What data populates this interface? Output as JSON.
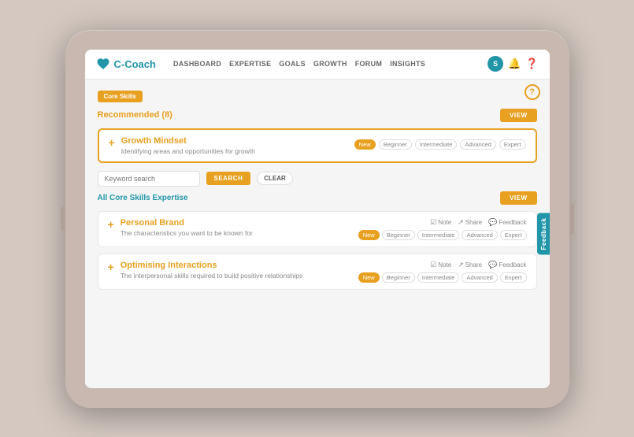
{
  "app": {
    "logo_text": "C-Coach",
    "nav": {
      "items": [
        {
          "label": "DASHBOARD"
        },
        {
          "label": "EXPERTISE"
        },
        {
          "label": "GOALS"
        },
        {
          "label": "GROWTH"
        },
        {
          "label": "FORUM"
        },
        {
          "label": "INSIGHTS"
        }
      ],
      "user_initial": "S"
    }
  },
  "content": {
    "help_icon": "?",
    "core_skills_badge": "Core Skills",
    "recommended_label": "Recommended (8)",
    "view_btn": "VIEW",
    "growth_card": {
      "title": "Growth Mindset",
      "description": "Identifying areas and opportunities for growth",
      "levels": [
        {
          "label": "New",
          "active": true
        },
        {
          "label": "Beginner",
          "active": false
        },
        {
          "label": "Intermediate",
          "active": false
        },
        {
          "label": "Advanced",
          "active": false
        },
        {
          "label": "Expert",
          "active": false
        }
      ]
    },
    "search": {
      "placeholder": "Keyword search",
      "search_btn": "SEARCH",
      "clear_btn": "CLEAR"
    },
    "all_core_skills_label": "All Core Skills Expertise",
    "all_view_btn": "VIEW",
    "feedback_tab": "Feedback",
    "skill_cards": [
      {
        "title": "Personal Brand",
        "description": "The characteristics you want to be known for",
        "actions": [
          "Note",
          "Share",
          "Feedback"
        ],
        "levels": [
          {
            "label": "New",
            "active": true
          },
          {
            "label": "Beginner",
            "active": false
          },
          {
            "label": "Intermediate",
            "active": false
          },
          {
            "label": "Advanced",
            "active": false
          },
          {
            "label": "Expert",
            "active": false
          }
        ]
      },
      {
        "title": "Optimising Interactions",
        "description": "The interpersonal skills required to build positive relationships",
        "actions": [
          "Note",
          "Share",
          "Feedback"
        ],
        "levels": [
          {
            "label": "New",
            "active": true
          },
          {
            "label": "Beginner",
            "active": false
          },
          {
            "label": "Intermediate",
            "active": false
          },
          {
            "label": "Advanced",
            "active": false
          },
          {
            "label": "Expert",
            "active": false
          }
        ]
      }
    ]
  }
}
